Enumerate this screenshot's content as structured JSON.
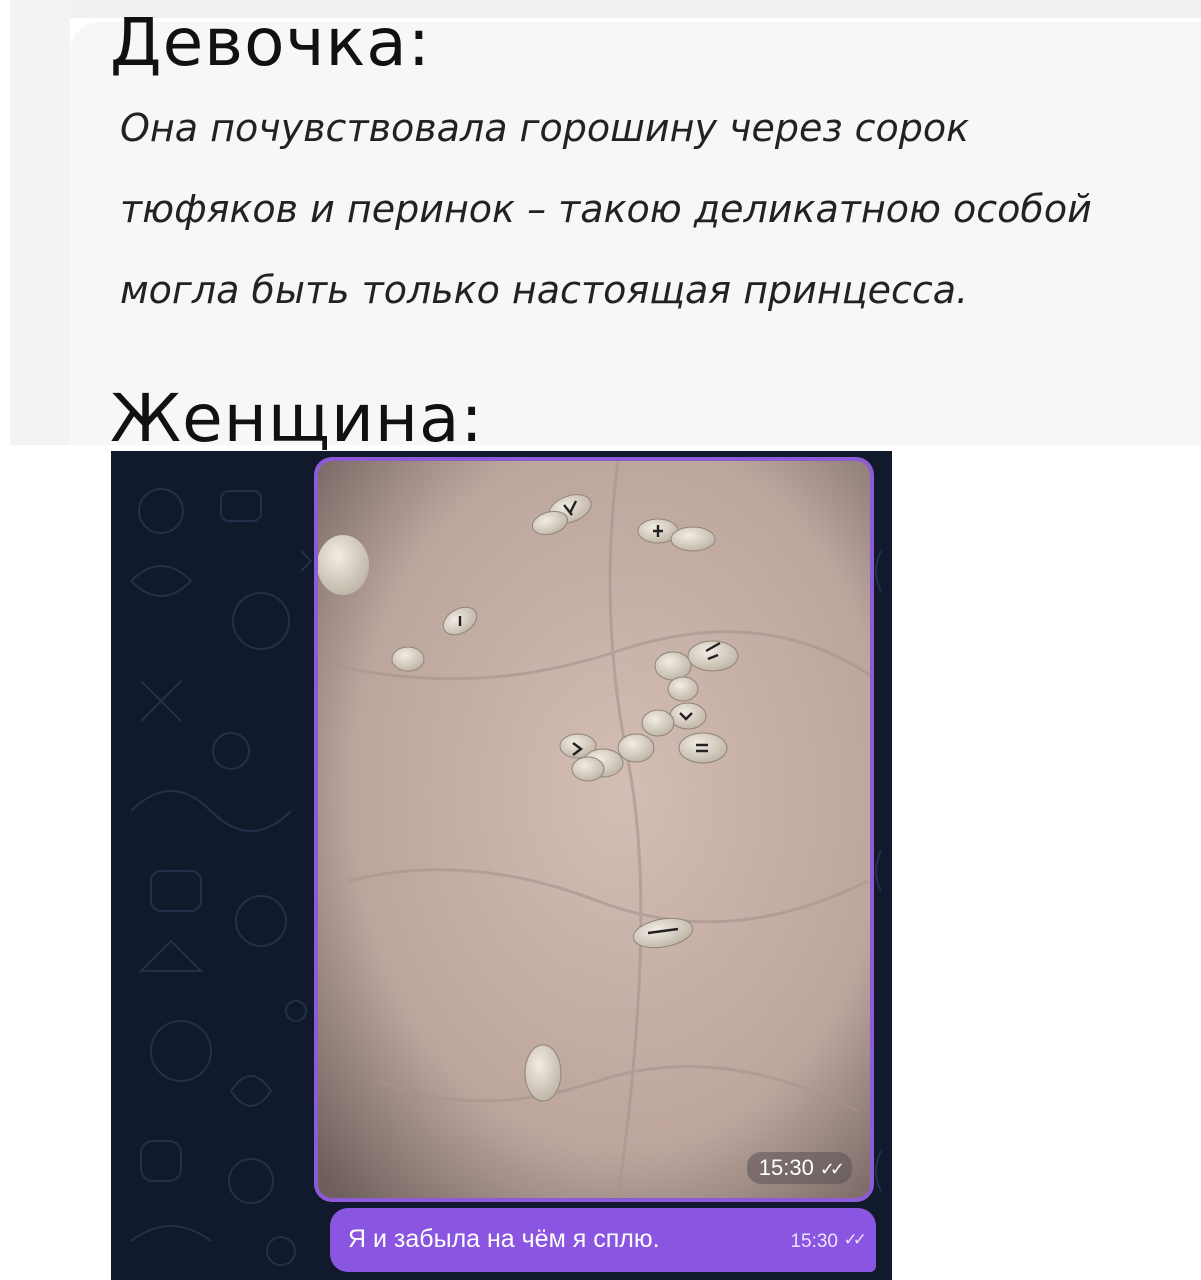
{
  "headings": {
    "girl": "Девочка:",
    "woman": "Женщина:"
  },
  "quote": "Она почувствовала горошину через сорок тюфяков и перинок – такою деликатною особой могла быть только настоящая принцесса.",
  "chat": {
    "photo_time": "15:30",
    "message": {
      "text": "Я и забыла на чём я сплю.",
      "time": "15:30"
    }
  },
  "colors": {
    "bubble": "#8a55e0",
    "chat_bg": "#101a2c",
    "photo_bg": "#c9b3ad"
  }
}
